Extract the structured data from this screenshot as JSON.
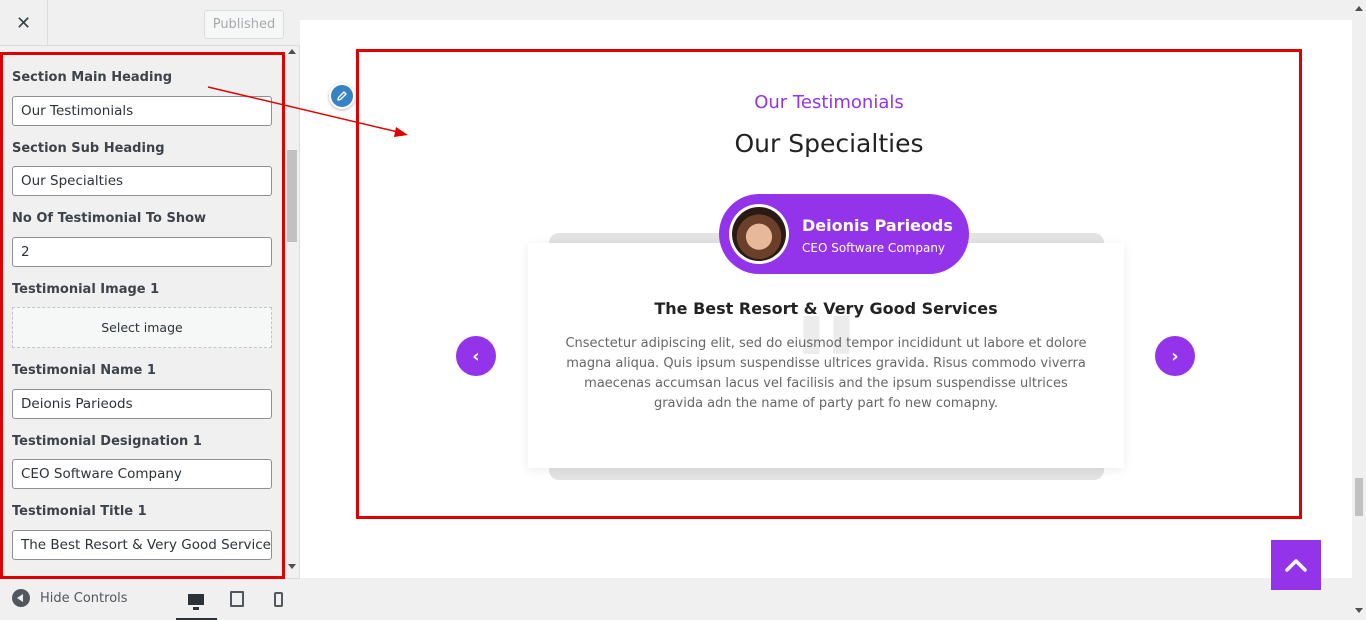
{
  "header": {
    "close_symbol": "✕",
    "publish_label": "Published"
  },
  "controls": {
    "fields": [
      {
        "label": "Section Main Heading",
        "value": "Our Testimonials"
      },
      {
        "label": "Section Sub Heading",
        "value": "Our Specialties"
      },
      {
        "label": "No Of Testimonial To Show",
        "value": "2"
      },
      {
        "label": "Testimonial Image 1",
        "button": "Select image"
      },
      {
        "label": "Testimonial Name 1",
        "value": "Deionis Parieods"
      },
      {
        "label": "Testimonial Designation 1",
        "value": "CEO Software Company"
      },
      {
        "label": "Testimonial Title 1",
        "value": "The Best Resort & Very Good Services"
      }
    ]
  },
  "footer": {
    "hide_controls_label": "Hide Controls",
    "devices": [
      "desktop-icon",
      "tablet-icon",
      "mobile-icon"
    ]
  },
  "preview": {
    "section_heading": "Our Testimonials",
    "section_subheading": "Our Specialties",
    "testimonial": {
      "name": "Deionis Parieods",
      "designation": "CEO Software Company",
      "title": "The Best Resort & Very Good Services",
      "text": "Cnsectetur adipiscing elit, sed do eiusmod tempor incididunt ut labore et dolore magna aliqua. Quis ipsum suspendisse ultrices gravida. Risus commodo viverra maecenas accumsan lacus vel facilisis and the ipsum suspendisse ultrices gravida adn the name of party part fo new comapny."
    },
    "prev_symbol": "‹",
    "next_symbol": "›"
  },
  "colors": {
    "accent": "#9333ea",
    "highlight": "#e00000",
    "edit": "#3582c4"
  }
}
